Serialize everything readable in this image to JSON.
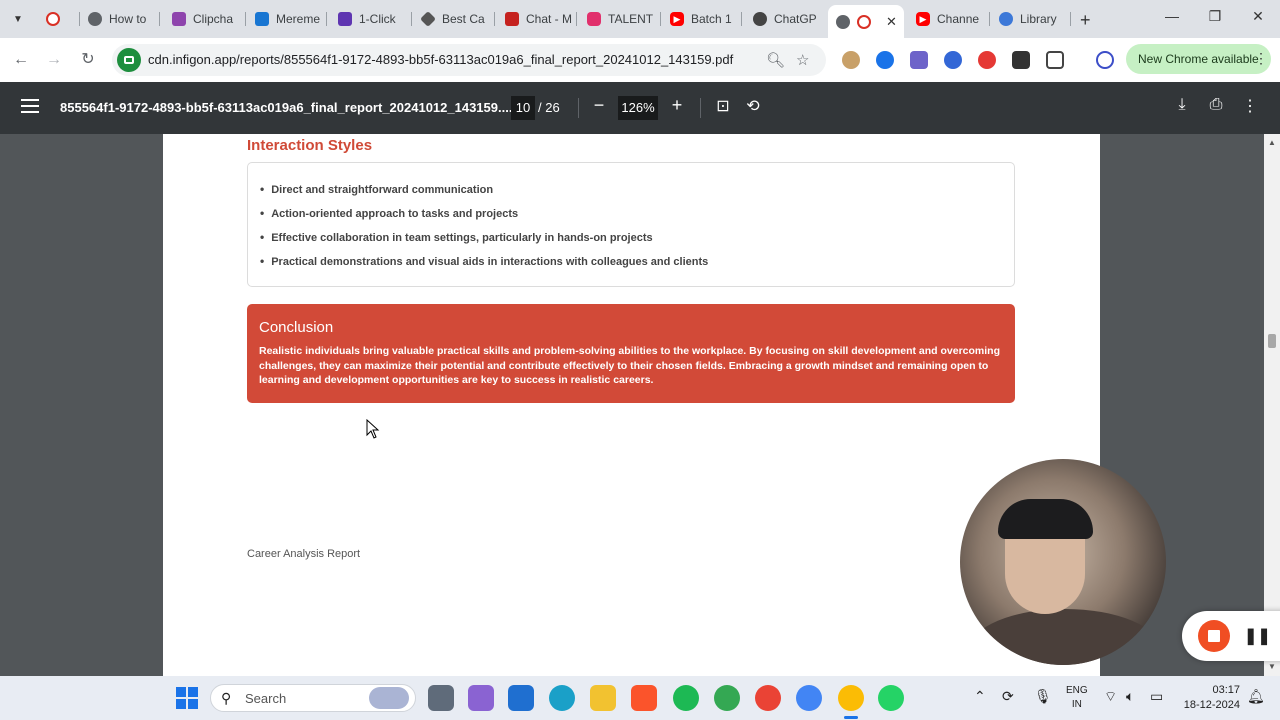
{
  "browser": {
    "tabs": [
      {
        "label": "",
        "icon": "record-icon",
        "color": "#d93025"
      },
      {
        "label": "How to",
        "icon": "globe-icon",
        "color": "#5f6368"
      },
      {
        "label": "Clipcha",
        "icon": "clipchamp-icon",
        "color": "#8e44ad"
      },
      {
        "label": "Mereme",
        "icon": "app-icon",
        "color": "#1976d2"
      },
      {
        "label": "1-Click",
        "icon": "app-icon",
        "color": "#5e35b1"
      },
      {
        "label": "Best Ca",
        "icon": "app-icon",
        "color": "#555555"
      },
      {
        "label": "Chat - M",
        "icon": "gmail-icon",
        "color": "#c5221f"
      },
      {
        "label": "TALENT",
        "icon": "instagram-icon",
        "color": "#e1306c"
      },
      {
        "label": "Batch 1",
        "icon": "youtube-icon",
        "color": "#ff0000"
      },
      {
        "label": "ChatGP",
        "icon": "chatgpt-icon",
        "color": "#444444"
      },
      {
        "label": "Channe",
        "icon": "youtube-icon",
        "color": "#ff0000"
      },
      {
        "label": "Library",
        "icon": "library-icon",
        "color": "#3c78d8"
      }
    ],
    "active_tab": {
      "label": "",
      "close_glyph": "✕"
    },
    "new_tab_glyph": "+",
    "window_controls": {
      "minimize": "—",
      "maximize": "❐",
      "close": "✕"
    },
    "url": "cdn.infigon.app/reports/855564f1-9172-4893-bb5f-63113ac019a6_final_report_20241012_143159.pdf",
    "new_chrome_label": "New Chrome available",
    "menu_glyph": "⋮"
  },
  "pdf_toolbar": {
    "title": "855564f1-9172-4893-bb5f-63113ac019a6_final_report_20241012_143159....",
    "page_current": "10",
    "page_total": "/ 26",
    "zoom": "126%",
    "zoom_out_glyph": "−",
    "zoom_in_glyph": "+"
  },
  "document": {
    "interaction_heading": "Interaction Styles",
    "interaction_items": [
      "Direct and straightforward communication",
      "Action-oriented approach to tasks and projects",
      "Effective collaboration in team settings, particularly in hands-on projects",
      "Practical demonstrations and visual aids in interactions with colleagues and clients"
    ],
    "conclusion_heading": "Conclusion",
    "conclusion_text": "Realistic individuals bring valuable practical skills and problem-solving abilities to the workplace. By focusing on skill development and overcoming challenges, they can maximize their potential and contribute effectively to their chosen fields. Embracing a growth mindset and remaining open to learning and development opportunities are key to success in realistic careers.",
    "footer": "Career Analysis Report",
    "accent_color": "#d24a38"
  },
  "taskbar": {
    "search_placeholder": "Search",
    "lang_line1": "ENG",
    "lang_line2": "IN",
    "time": "03:17",
    "date": "18-12-2024"
  }
}
